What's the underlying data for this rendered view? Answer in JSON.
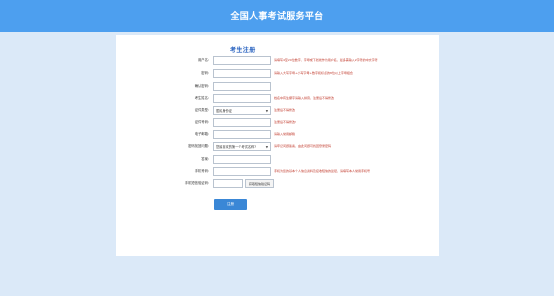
{
  "header": {
    "title": "全国人事考试服务平台"
  },
  "form": {
    "title": "考生注册",
    "rows": [
      {
        "label": "用户名:",
        "value": "",
        "hint": "请填写4至20位数字、字母或下划线作为用户名，最多需输入2字符的中文字符"
      },
      {
        "label": "密码:",
        "value": "",
        "hint": "请输入大写字母+小写字母+数字和标点的8位以上字母组合"
      },
      {
        "label": "确认密码:",
        "value": "",
        "hint": ""
      },
      {
        "label": "考生姓名:",
        "value": "",
        "hint": "姓名中有生僻字请输入拼音，注册后不得修改"
      },
      {
        "label": "证件类型:",
        "value": "居民身份证",
        "hint": "注册后不得修改"
      },
      {
        "label": "证件号码:",
        "value": "",
        "hint": "注册后不得修改!"
      },
      {
        "label": "电子邮箱:",
        "value": "",
        "hint": "请输入常用邮箱"
      },
      {
        "label": "密码找回问题:",
        "value": "您最喜欢的第一个考试名称?",
        "hint": "请牢记问题答案，由此问题可找回登录密码"
      },
      {
        "label": "答案:",
        "value": "",
        "hint": ""
      },
      {
        "label": "手机号码:",
        "value": "",
        "hint": "手机为您的基本个人信息资料及接收短信的途径，请填写本人常用手机号"
      },
      {
        "label": "手机短信验证码:",
        "value": "",
        "hint": ""
      }
    ],
    "captcha_button": "获取短信验证码",
    "submit_label": "注册"
  }
}
